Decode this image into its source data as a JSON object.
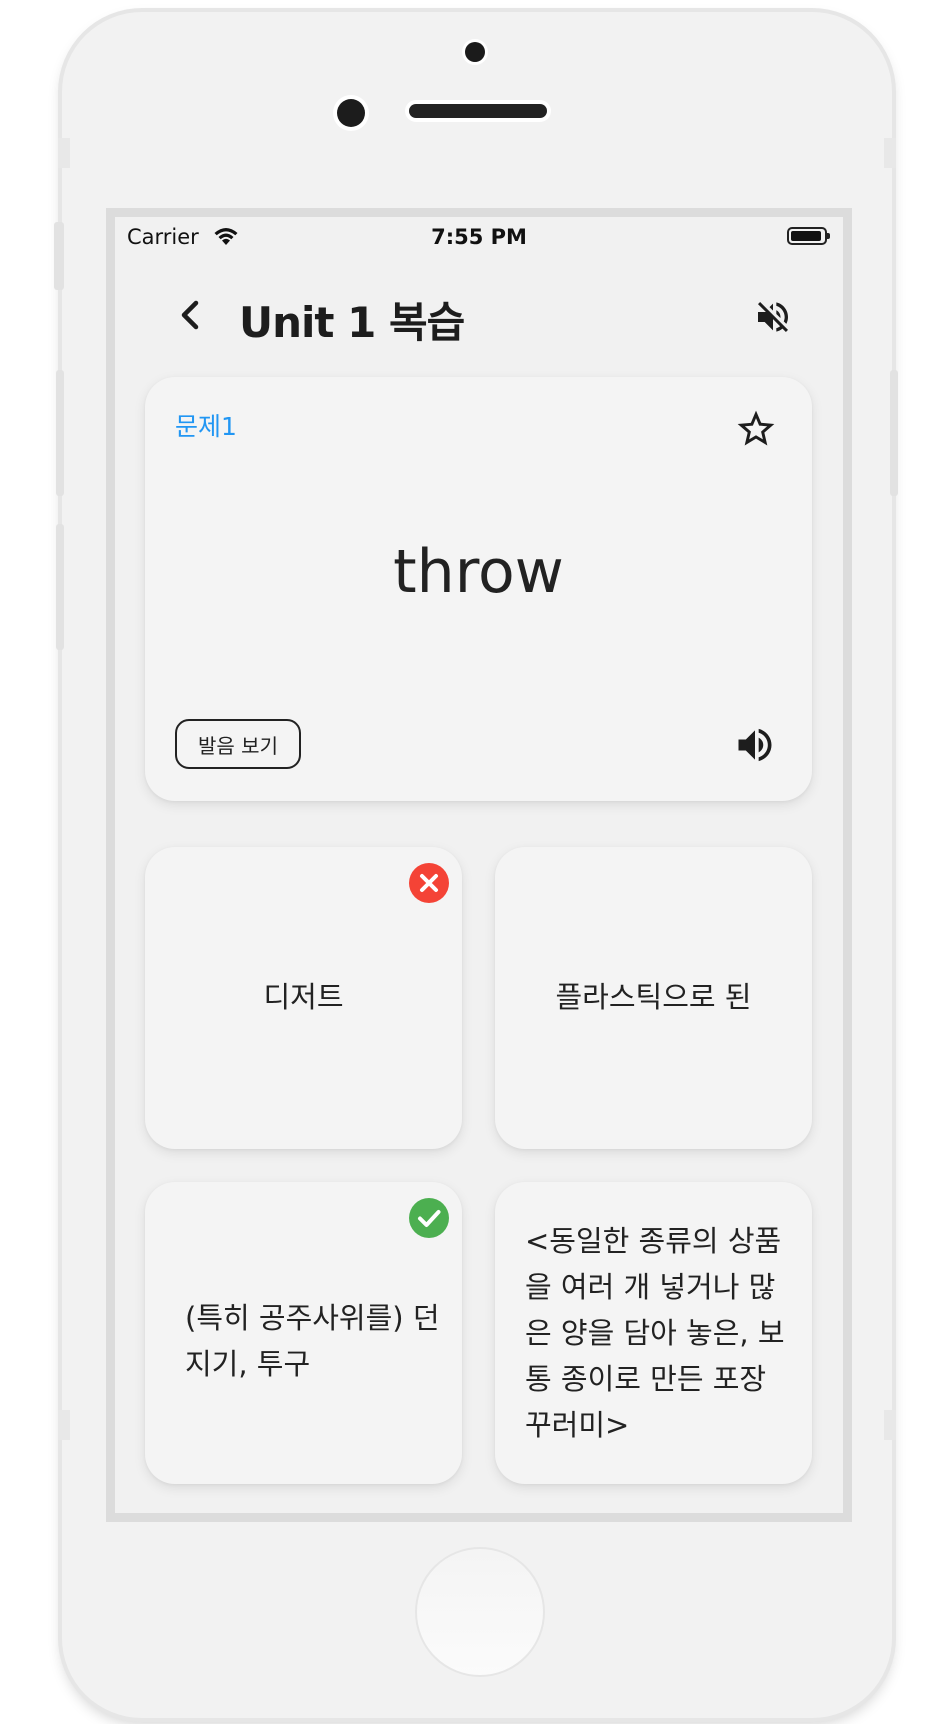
{
  "status_bar": {
    "carrier": "Carrier",
    "time": "7:55 PM"
  },
  "header": {
    "title": "Unit 1 복습"
  },
  "question": {
    "number_label": "문제1",
    "word": "throw",
    "pronunciation_button": "발음 보기"
  },
  "options": [
    {
      "text": "디저트",
      "state": "wrong"
    },
    {
      "text": "플라스틱으로 된",
      "state": "none"
    },
    {
      "text": "(특히 공주사위를) 던지기, 투구",
      "state": "correct"
    },
    {
      "text": "<동일한 종류의 상품을 여러 개 넣거나 많은 양을 담아 놓은, 보통 종이로 만든 포장 꾸러미>",
      "state": "none"
    }
  ],
  "colors": {
    "accent": "#2196f3",
    "wrong": "#f44336",
    "correct": "#4caf50"
  },
  "icons": [
    "back-arrow-icon",
    "volume-off-icon",
    "star-outline-icon",
    "volume-up-icon",
    "wifi-icon",
    "battery-icon",
    "cancel-icon",
    "check-circle-icon"
  ]
}
